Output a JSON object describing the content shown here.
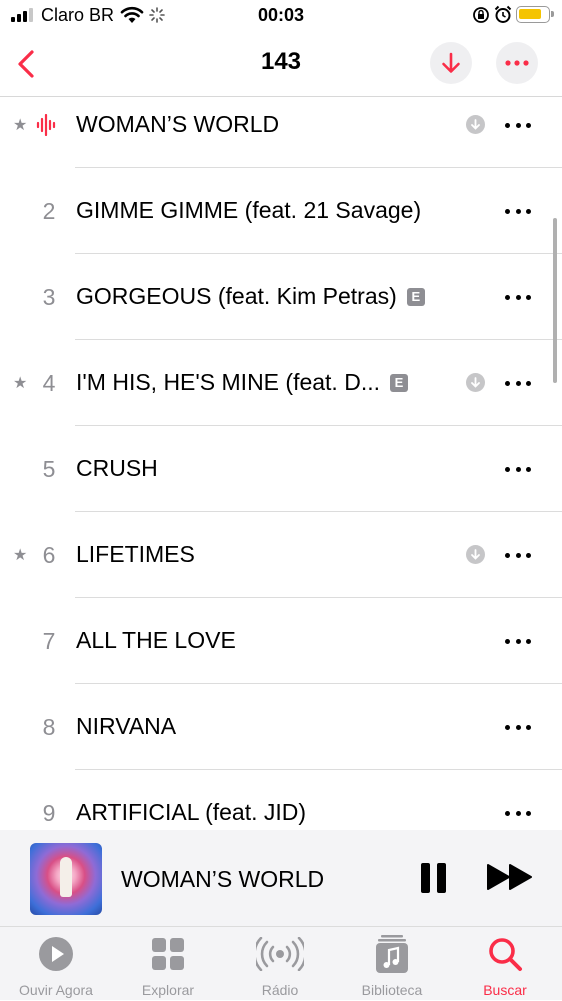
{
  "status_bar": {
    "carrier": "Claro BR",
    "time": "00:03",
    "battery_color": "#f5c400"
  },
  "nav": {
    "title": "143",
    "back_icon": "chevron-left-icon",
    "download_icon": "arrow-down-icon",
    "more_icon": "ellipsis-icon",
    "accent": "#fa2d48"
  },
  "tracks": [
    {
      "number": "",
      "title": "WOMAN’S WORLD",
      "starred": true,
      "playing": true,
      "explicit": false,
      "downloaded": true
    },
    {
      "number": "2",
      "title": "GIMME GIMME (feat. 21 Savage)",
      "starred": false,
      "playing": false,
      "explicit": false,
      "downloaded": false
    },
    {
      "number": "3",
      "title": "GORGEOUS (feat. Kim Petras)",
      "starred": false,
      "playing": false,
      "explicit": true,
      "downloaded": false
    },
    {
      "number": "4",
      "title": "I'M HIS, HE'S MINE (feat. D...",
      "starred": true,
      "playing": false,
      "explicit": true,
      "downloaded": true
    },
    {
      "number": "5",
      "title": "CRUSH",
      "starred": false,
      "playing": false,
      "explicit": false,
      "downloaded": false
    },
    {
      "number": "6",
      "title": "LIFETIMES",
      "starred": true,
      "playing": false,
      "explicit": false,
      "downloaded": true
    },
    {
      "number": "7",
      "title": "ALL THE LOVE",
      "starred": false,
      "playing": false,
      "explicit": false,
      "downloaded": false
    },
    {
      "number": "8",
      "title": "NIRVANA",
      "starred": false,
      "playing": false,
      "explicit": false,
      "downloaded": false
    },
    {
      "number": "9",
      "title": "ARTIFICIAL (feat. JID)",
      "starred": false,
      "playing": false,
      "explicit": false,
      "downloaded": false
    }
  ],
  "explicit_badge": "E",
  "star_glyph": "★",
  "mini_player": {
    "title": "WOMAN’S WORLD",
    "pause_icon": "pause-icon",
    "forward_icon": "fast-forward-icon"
  },
  "tabs": [
    {
      "label": "Ouvir Agora",
      "icon": "play-circle-icon",
      "active": false
    },
    {
      "label": "Explorar",
      "icon": "grid-icon",
      "active": false
    },
    {
      "label": "Rádio",
      "icon": "radio-waves-icon",
      "active": false
    },
    {
      "label": "Biblioteca",
      "icon": "music-library-icon",
      "active": false
    },
    {
      "label": "Buscar",
      "icon": "search-icon",
      "active": true
    }
  ]
}
